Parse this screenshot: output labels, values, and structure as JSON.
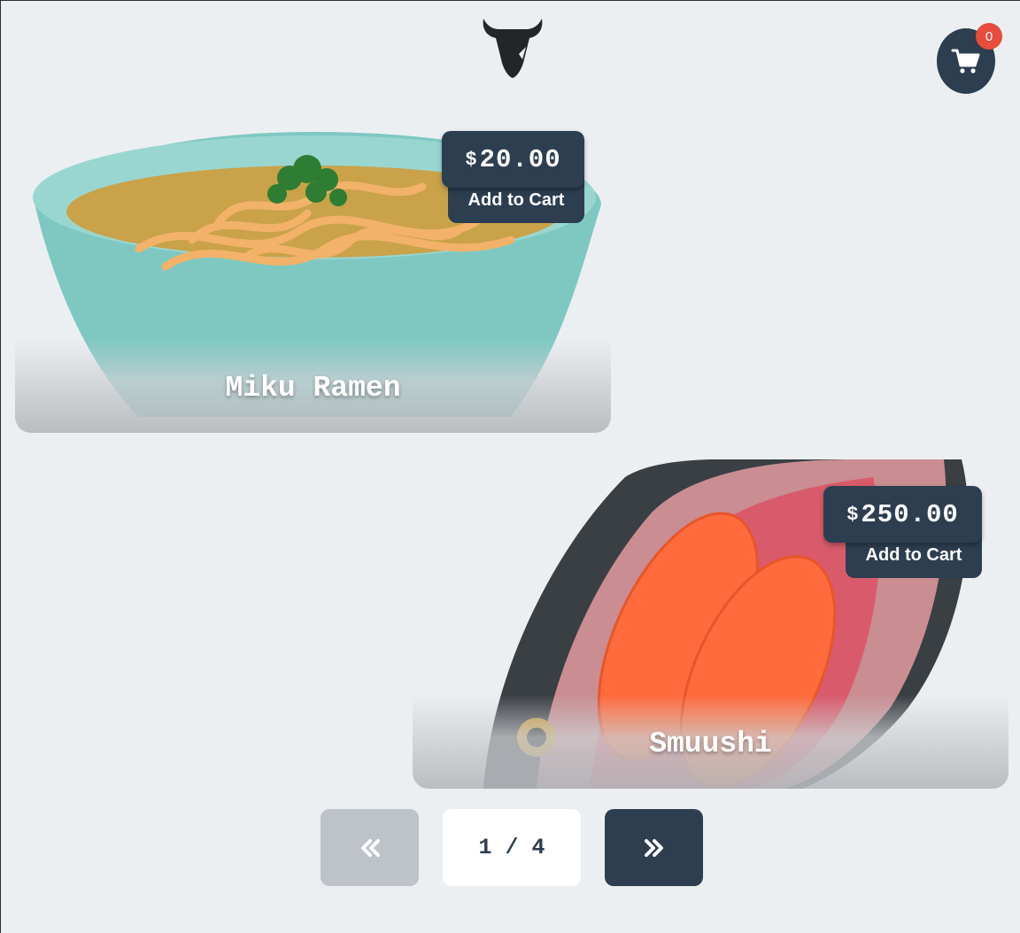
{
  "header": {
    "logo_icon": "bull-head-icon",
    "cart_icon": "shopping-cart-icon",
    "cart_count": "0"
  },
  "products": [
    {
      "name": "Miku Ramen",
      "currency": "$",
      "price": "20.00",
      "add_label": "Add to Cart"
    },
    {
      "name": "Smuushi",
      "currency": "$",
      "price": "250.00",
      "add_label": "Add to Cart"
    }
  ],
  "pagination": {
    "prev_icon": "double-chevron-left-icon",
    "next_icon": "double-chevron-right-icon",
    "indicator": "1 / 4"
  },
  "colors": {
    "dark": "#2c3e50",
    "badge": "#e74c3c",
    "background": "#eceff1",
    "disabled": "#bdc3c8"
  }
}
